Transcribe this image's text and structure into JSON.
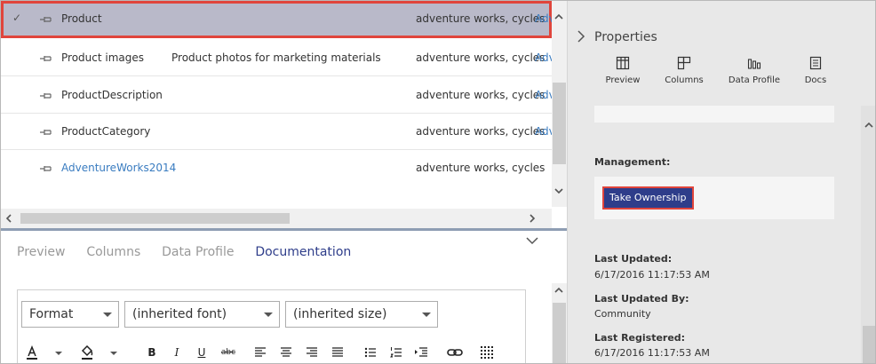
{
  "asset_list": {
    "rows": [
      {
        "name": "Product",
        "description": "",
        "tags": "adventure works, cycles",
        "more": "Adv",
        "selected": true,
        "name_is_link": false
      },
      {
        "name": "Product images",
        "description": "Product photos for marketing materials",
        "tags": "adventure works, cycles",
        "more": "Adv",
        "selected": false,
        "name_is_link": false
      },
      {
        "name": "ProductDescription",
        "description": "",
        "tags": "adventure works, cycles",
        "more": "Adv",
        "selected": false,
        "name_is_link": false
      },
      {
        "name": "ProductCategory",
        "description": "",
        "tags": "adventure works, cycles",
        "more": "Adv",
        "selected": false,
        "name_is_link": false
      },
      {
        "name": "AdventureWorks2014",
        "description": "",
        "tags": "adventure works, cycles",
        "more": "",
        "selected": false,
        "name_is_link": true
      }
    ]
  },
  "bottom": {
    "tabs": [
      {
        "label": "Preview",
        "active": false
      },
      {
        "label": "Columns",
        "active": false
      },
      {
        "label": "Data Profile",
        "active": false
      },
      {
        "label": "Documentation",
        "active": true
      }
    ],
    "editor": {
      "format_select": "Format",
      "font_select": "(inherited font)",
      "size_select": "(inherited size)",
      "tools": {
        "bold": "B",
        "italic": "I",
        "underline": "U",
        "strike": "abc"
      }
    }
  },
  "properties": {
    "title": "Properties",
    "toolbar": [
      {
        "label": "Preview",
        "icon": "table-icon"
      },
      {
        "label": "Columns",
        "icon": "columns-icon"
      },
      {
        "label": "Data Profile",
        "icon": "bar-chart-icon"
      },
      {
        "label": "Docs",
        "icon": "document-icon"
      }
    ],
    "management_label": "Management:",
    "take_ownership": "Take Ownership",
    "last_updated_label": "Last Updated:",
    "last_updated_value": "6/17/2016 11:17:53 AM",
    "last_updated_by_label": "Last Updated By:",
    "last_updated_by_value": "Community",
    "last_registered_label": "Last Registered:",
    "last_registered_value": "6/17/2016 11:17:53 AM"
  },
  "colors": {
    "selection": "#b9b9c9",
    "highlight_border": "#e0453c",
    "accent": "#2e3d8a",
    "link": "#3a7cc0"
  }
}
